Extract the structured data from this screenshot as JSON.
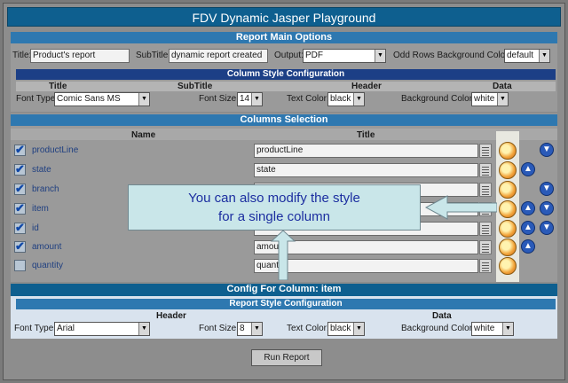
{
  "app": {
    "title": "FDV Dynamic Jasper Playground"
  },
  "main_options": {
    "header": "Report Main Options",
    "title_label": "Title:",
    "title_value": "Product's report",
    "subtitle_label": "SubTitle:",
    "subtitle_value": "dynamic report created",
    "output_label": "Output:",
    "output_value": "PDF",
    "oddrows_label": "Odd Rows Background Color:",
    "oddrows_value": "default"
  },
  "column_style": {
    "header": "Column Style Configuration",
    "groups": [
      "Title",
      "SubTitle",
      "Header",
      "Data"
    ],
    "font_type_label": "Font Type:",
    "font_type_value": "Comic Sans MS",
    "font_size_label": "Font Size:",
    "font_size_value": "14",
    "text_color_label": "Text Color:",
    "text_color_value": "black",
    "bg_color_label": "Background Color:",
    "bg_color_value": "white"
  },
  "columns_selection": {
    "header": "Columns Selection",
    "name_col": "Name",
    "title_col": "Title",
    "rows": [
      {
        "name": "productLine",
        "title": "productLine",
        "checked": true
      },
      {
        "name": "state",
        "title": "state",
        "checked": true
      },
      {
        "name": "branch",
        "title": "",
        "checked": true
      },
      {
        "name": "item",
        "title": "",
        "checked": true
      },
      {
        "name": "id",
        "title": "id",
        "checked": true
      },
      {
        "name": "amount",
        "title": "amount",
        "checked": true
      },
      {
        "name": "quantity",
        "title": "quantity",
        "checked": false
      }
    ]
  },
  "callout": {
    "line1": "You can also modify the style",
    "line2": "for a single column"
  },
  "config_column": {
    "header": "Config For Column: item",
    "sub_header": "Report Style Configuration",
    "groups": [
      "Header",
      "Data"
    ],
    "font_type_label": "Font Type:",
    "font_type_value": "Arial",
    "font_size_label": "Font Size:",
    "font_size_value": "8",
    "text_color_label": "Text Color:",
    "text_color_value": "black",
    "bg_color_label": "Background Color:",
    "bg_color_value": "white"
  },
  "run_button": "Run Report",
  "colors": {
    "title_bar": "#0e5f8f",
    "section_bar": "#2e78b0",
    "sub_bar": "#1c3f86",
    "callout_bg": "#c9e6e9",
    "callout_text": "#1c2ea0"
  }
}
